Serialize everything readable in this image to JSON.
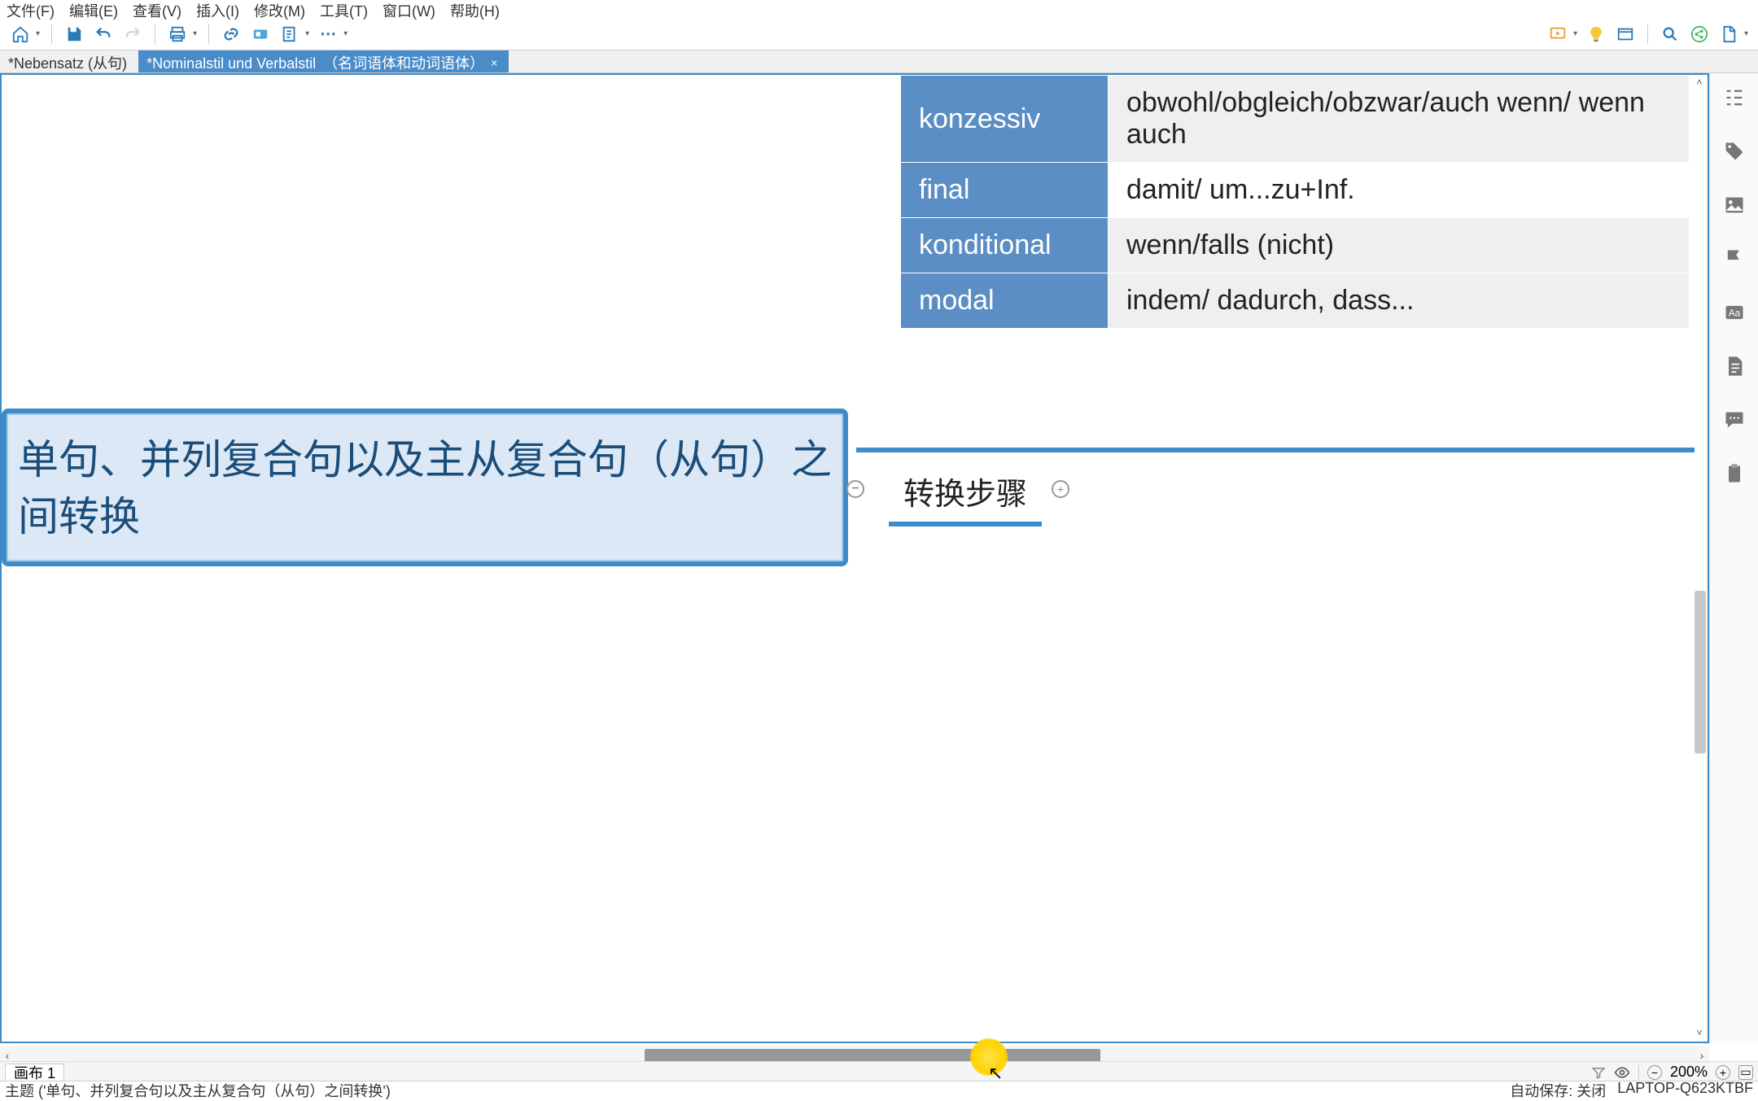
{
  "menu": {
    "file": "文件(F)",
    "edit": "编辑(E)",
    "view": "查看(V)",
    "insert": "插入(I)",
    "modify": "修改(M)",
    "tools": "工具(T)",
    "window": "窗口(W)",
    "help": "帮助(H)"
  },
  "tabs": [
    {
      "label": "*Nebensatz (从句)",
      "active": false
    },
    {
      "label": "*Nominalstil und Verbalstil　（名词语体和动词语体）",
      "active": true
    }
  ],
  "grammar": [
    {
      "type": "konzessiv",
      "words": "obwohl/obgleich/obzwar/auch wenn/ wenn auch"
    },
    {
      "type": "final",
      "words": "damit/ um...zu+Inf."
    },
    {
      "type": "konditional",
      "words": "wenn/falls (nicht)"
    },
    {
      "type": "modal",
      "words": "indem/ dadurch, dass..."
    }
  ],
  "main_topic": "单句、并列复合句以及主从复合句（从句）之间转换",
  "sub_topic": "转换步骤",
  "canvas_tab": "画布 1",
  "zoom": "200%",
  "status_left": "主题 ('单句、并列复合句以及主从复合句（从句）之间转换')",
  "status_autosave": "自动保存: 关闭",
  "status_host": "LAPTOP-Q623KTBF"
}
